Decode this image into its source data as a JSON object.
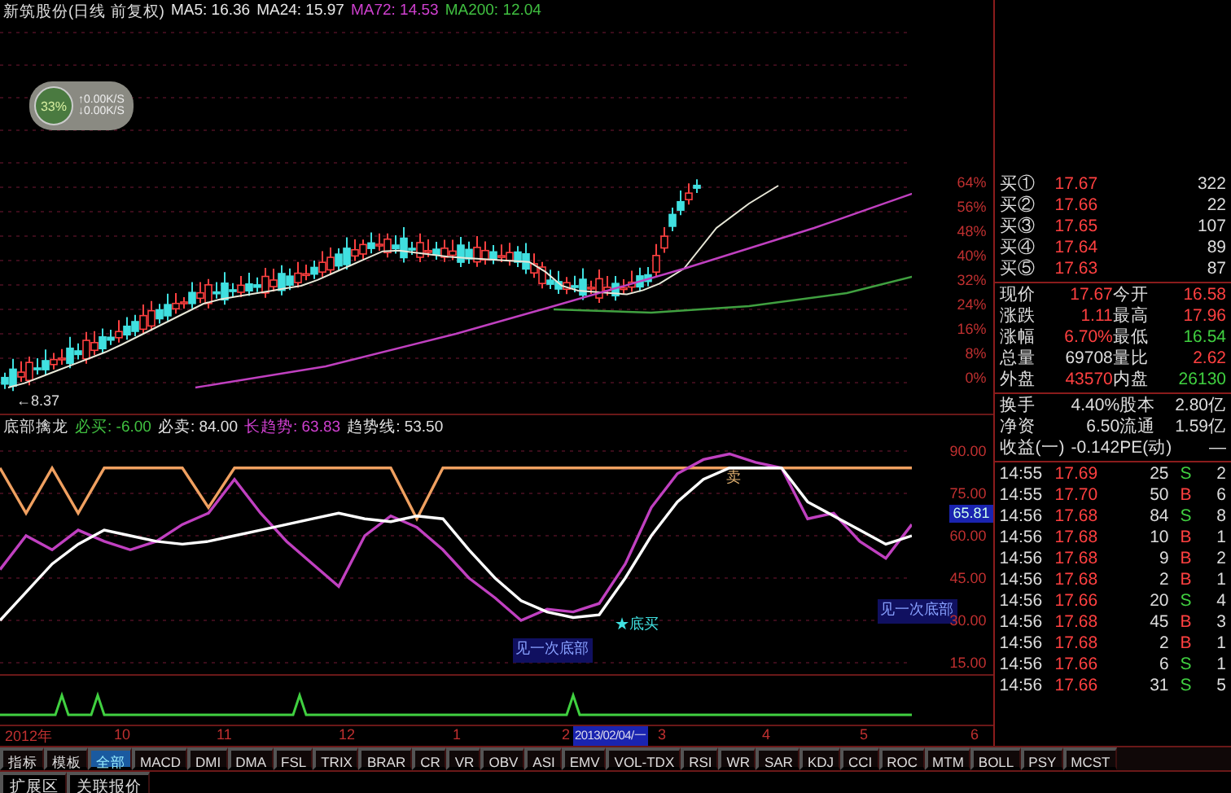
{
  "header": {
    "title": "新筑股份(日线 前复权)",
    "ma": [
      {
        "label": "MA5: 16.36",
        "color": "#e8e8e8"
      },
      {
        "label": "MA24: 15.97",
        "color": "#e8e8e8"
      },
      {
        "label": "MA72: 14.53",
        "color": "#d040d0"
      },
      {
        "label": "MA200: 12.04",
        "color": "#40c040"
      }
    ]
  },
  "speed_widget": {
    "percent": "33%",
    "upload": "↑0.00K/S",
    "download": "↓0.00K/S"
  },
  "price_chart": {
    "low_marker": "←8.37",
    "axis": [
      "64%",
      "56%",
      "48%",
      "40%",
      "32%",
      "24%",
      "16%",
      "8%",
      "0%"
    ]
  },
  "indicator": {
    "name": "底部擒龙",
    "values": [
      {
        "label": "必买: -6.00",
        "color": "#40c040"
      },
      {
        "label": "必卖: 84.00",
        "color": "#e0e0e0"
      },
      {
        "label": "长趋势: 63.83",
        "color": "#d040d0"
      },
      {
        "label": "趋势线: 53.50",
        "color": "#e0e0e0"
      }
    ],
    "markers": [
      {
        "kind": "sell",
        "text": "卖"
      },
      {
        "kind": "buy",
        "text": "★底买"
      },
      {
        "kind": "bottom",
        "text": "见一次底部"
      },
      {
        "kind": "bottom",
        "text": "见一次底部"
      }
    ],
    "current": "65.81",
    "chart_data": {
      "type": "line",
      "grid": true,
      "ylim": [
        15,
        90
      ],
      "yticks": [
        {
          "value": 90,
          "label": "90.00"
        },
        {
          "value": 75,
          "label": "75.00"
        },
        {
          "value": 60,
          "label": "60.00"
        },
        {
          "value": 45,
          "label": "45.00"
        },
        {
          "value": 30,
          "label": "30.00"
        },
        {
          "value": 15,
          "label": "15.00"
        }
      ],
      "series": [
        {
          "color": "#f0a060",
          "values": [
            84,
            68,
            84,
            68,
            84,
            84,
            84,
            84,
            70,
            84,
            84,
            84,
            84,
            84,
            84,
            84,
            66,
            84,
            84,
            84,
            84,
            84,
            84,
            84,
            84,
            84,
            84,
            84,
            84,
            84,
            84,
            84,
            84,
            84,
            84,
            84
          ]
        },
        {
          "color": "#c040c0",
          "values": [
            48,
            60,
            55,
            62,
            58,
            55,
            58,
            64,
            68,
            80,
            68,
            58,
            50,
            42,
            60,
            67,
            63,
            55,
            45,
            38,
            30,
            34,
            33,
            36,
            50,
            70,
            82,
            87,
            89,
            86,
            84,
            66,
            68,
            58,
            52,
            64
          ]
        },
        {
          "color": "#ffffff",
          "values": [
            30,
            40,
            50,
            57,
            62,
            60,
            58,
            57,
            58,
            60,
            62,
            64,
            66,
            68,
            66,
            65,
            67,
            66,
            55,
            45,
            37,
            33,
            31,
            32,
            45,
            60,
            72,
            80,
            84,
            84,
            84,
            72,
            67,
            62,
            57,
            60
          ]
        }
      ]
    }
  },
  "time_axis": {
    "labels": [
      "2012年",
      "10",
      "11",
      "12",
      "1",
      "2",
      "3",
      "4",
      "5",
      "6"
    ],
    "cursor_date": "2013/02/04/一"
  },
  "tabs": [
    {
      "label": "指标",
      "selected": false
    },
    {
      "label": "模板",
      "selected": false
    },
    {
      "label": "全部",
      "selected": true
    },
    {
      "label": "MACD",
      "selected": false
    },
    {
      "label": "DMI",
      "selected": false
    },
    {
      "label": "DMA",
      "selected": false
    },
    {
      "label": "FSL",
      "selected": false
    },
    {
      "label": "TRIX",
      "selected": false
    },
    {
      "label": "BRAR",
      "selected": false
    },
    {
      "label": "CR",
      "selected": false
    },
    {
      "label": "VR",
      "selected": false
    },
    {
      "label": "OBV",
      "selected": false
    },
    {
      "label": "ASI",
      "selected": false
    },
    {
      "label": "EMV",
      "selected": false
    },
    {
      "label": "VOL-TDX",
      "selected": false
    },
    {
      "label": "RSI",
      "selected": false
    },
    {
      "label": "WR",
      "selected": false
    },
    {
      "label": "SAR",
      "selected": false
    },
    {
      "label": "KDJ",
      "selected": false
    },
    {
      "label": "CCI",
      "selected": false
    },
    {
      "label": "ROC",
      "selected": false
    },
    {
      "label": "MTM",
      "selected": false
    },
    {
      "label": "BOLL",
      "selected": false
    },
    {
      "label": "PSY",
      "selected": false
    },
    {
      "label": "MCST",
      "selected": false
    }
  ],
  "bottom_bar": [
    "扩展区",
    "关联报价"
  ],
  "quote": {
    "bids": [
      {
        "label": "买①",
        "price": "17.67",
        "volume": "322"
      },
      {
        "label": "买②",
        "price": "17.66",
        "volume": "22"
      },
      {
        "label": "买③",
        "price": "17.65",
        "volume": "107"
      },
      {
        "label": "买④",
        "price": "17.64",
        "volume": "89"
      },
      {
        "label": "买⑤",
        "price": "17.63",
        "volume": "87"
      }
    ],
    "stats": [
      {
        "label": "现价",
        "value": "17.67",
        "color": "#ff4040"
      },
      {
        "label": "今开",
        "value": "16.58",
        "color": "#ff4040"
      },
      {
        "label": "涨跌",
        "value": "1.11",
        "color": "#ff4040"
      },
      {
        "label": "最高",
        "value": "17.96",
        "color": "#ff4040"
      },
      {
        "label": "涨幅",
        "value": "6.70%",
        "color": "#ff4040"
      },
      {
        "label": "最低",
        "value": "16.54",
        "color": "#40d040"
      },
      {
        "label": "总量",
        "value": "69708",
        "color": "#dddddd"
      },
      {
        "label": "量比",
        "value": "2.62",
        "color": "#ff4040"
      },
      {
        "label": "外盘",
        "value": "43570",
        "color": "#ff4040"
      },
      {
        "label": "内盘",
        "value": "26130",
        "color": "#40d040"
      }
    ],
    "finance": [
      {
        "label": "换手",
        "value": "4.40%"
      },
      {
        "label": "股本",
        "value": "2.80亿"
      },
      {
        "label": "净资",
        "value": "6.50"
      },
      {
        "label": "流通",
        "value": "1.59亿"
      },
      {
        "label": "收益(一)",
        "value": "-0.142"
      },
      {
        "label": "PE(动)",
        "value": "—"
      }
    ],
    "trades": [
      {
        "time": "14:55",
        "price": "17.69",
        "volume": "25",
        "side": "S",
        "count": "2"
      },
      {
        "time": "14:55",
        "price": "17.70",
        "volume": "50",
        "side": "B",
        "count": "6"
      },
      {
        "time": "14:56",
        "price": "17.68",
        "volume": "84",
        "side": "S",
        "count": "8"
      },
      {
        "time": "14:56",
        "price": "17.68",
        "volume": "10",
        "side": "B",
        "count": "1"
      },
      {
        "time": "14:56",
        "price": "17.68",
        "volume": "9",
        "side": "B",
        "count": "2"
      },
      {
        "time": "14:56",
        "price": "17.68",
        "volume": "2",
        "side": "B",
        "count": "1"
      },
      {
        "time": "14:56",
        "price": "17.66",
        "volume": "20",
        "side": "S",
        "count": "4"
      },
      {
        "time": "14:56",
        "price": "17.68",
        "volume": "45",
        "side": "B",
        "count": "3"
      },
      {
        "time": "14:56",
        "price": "17.68",
        "volume": "2",
        "side": "B",
        "count": "1"
      },
      {
        "time": "14:56",
        "price": "17.66",
        "volume": "6",
        "side": "S",
        "count": "1"
      },
      {
        "time": "14:56",
        "price": "17.66",
        "volume": "31",
        "side": "S",
        "count": "5"
      }
    ]
  }
}
